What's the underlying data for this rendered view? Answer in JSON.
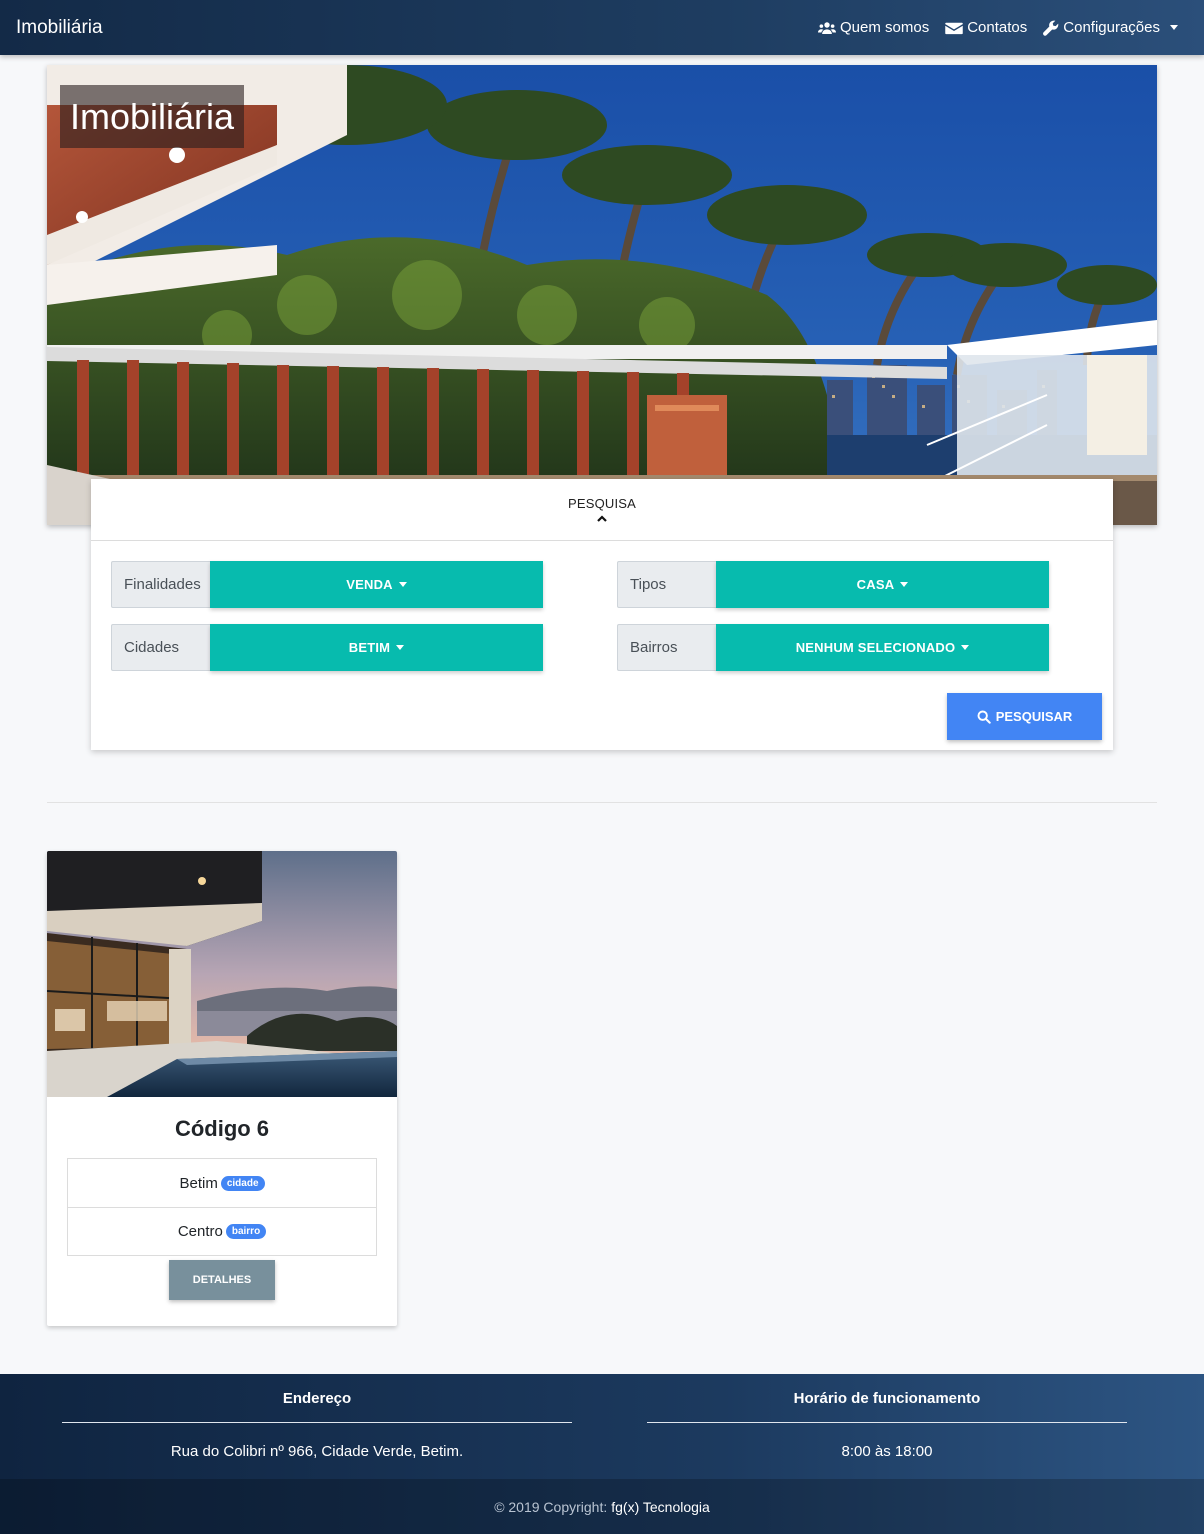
{
  "navbar": {
    "brand": "Imobiliária",
    "links": [
      {
        "label": "Quem somos",
        "icon": "users-icon"
      },
      {
        "label": "Contatos",
        "icon": "envelope-icon"
      },
      {
        "label": "Configurações",
        "icon": "wrench-icon",
        "dropdown": true
      }
    ]
  },
  "hero": {
    "title": "Imobiliária"
  },
  "search": {
    "header": "PESQUISA",
    "fields": {
      "finalidades": {
        "label": "Finalidades",
        "value": "VENDA"
      },
      "tipos": {
        "label": "Tipos",
        "value": "CASA"
      },
      "cidades": {
        "label": "Cidades",
        "value": "BETIM"
      },
      "bairros": {
        "label": "Bairros",
        "value": "NENHUM SELECIONADO"
      }
    },
    "button": "PESQUISAR"
  },
  "listing": {
    "title": "Código 6",
    "city": {
      "value": "Betim",
      "badge": "cidade"
    },
    "neighborhood": {
      "value": "Centro",
      "badge": "bairro"
    },
    "button": "DETALHES"
  },
  "footer": {
    "address": {
      "heading": "Endereço",
      "text": "Rua do Colibri nº 966, Cidade Verde, Betim."
    },
    "hours": {
      "heading": "Horário de funcionamento",
      "text": "8:00 às 18:00"
    },
    "copyright": "© 2019 Copyright:",
    "company": "fg(x) Tecnologia"
  },
  "colors": {
    "navbar": "#1e3d61",
    "dropdown": "#07bbae",
    "primary": "#4285f4",
    "details": "#78909c"
  }
}
